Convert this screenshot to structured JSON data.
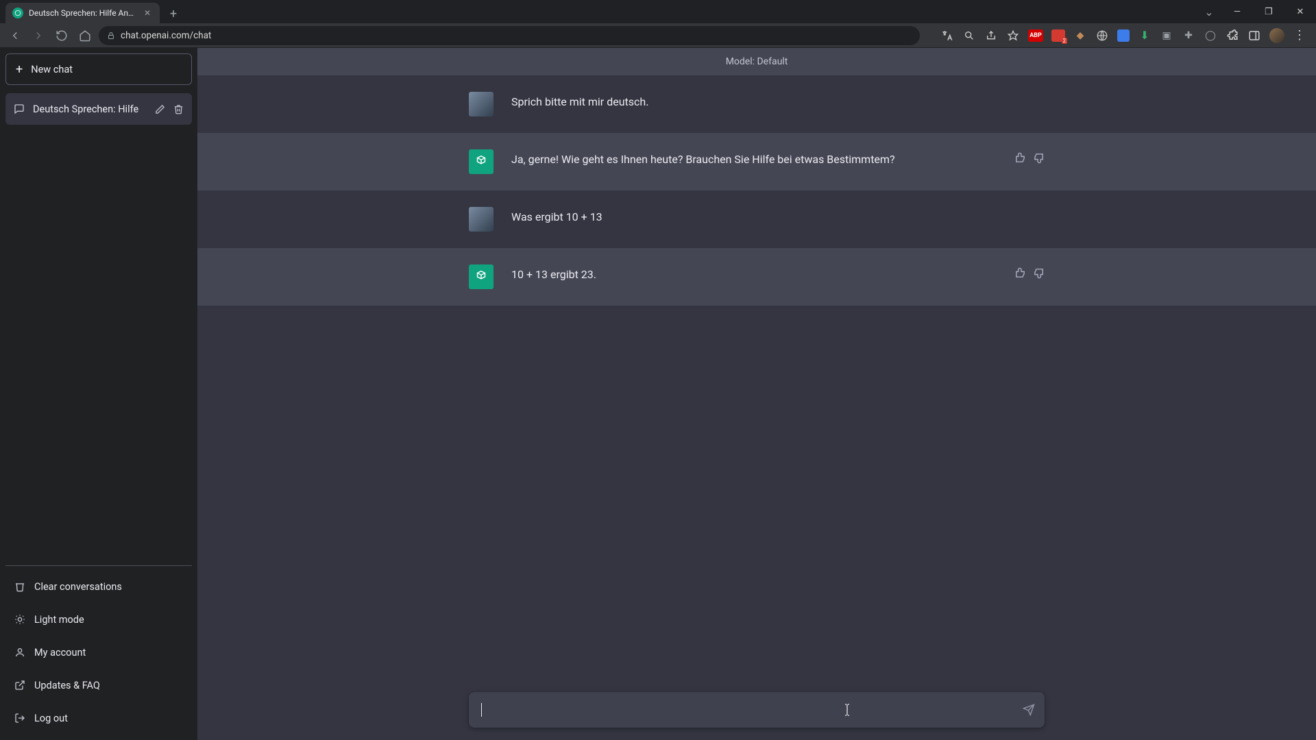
{
  "browser": {
    "tab_title": "Deutsch Sprechen: Hilfe Angebo",
    "url": "chat.openai.com/chat",
    "ext_abp": "ABP",
    "ext_red_badge": "2"
  },
  "sidebar": {
    "new_chat": "New chat",
    "conversations": [
      {
        "title": "Deutsch Sprechen: Hilfe"
      }
    ],
    "footer": {
      "clear": "Clear conversations",
      "light": "Light mode",
      "account": "My account",
      "updates": "Updates & FAQ",
      "logout": "Log out"
    }
  },
  "main": {
    "model_label": "Model: Default",
    "messages": [
      {
        "role": "user",
        "text": "Sprich bitte mit mir deutsch."
      },
      {
        "role": "assistant",
        "text": "Ja, gerne! Wie geht es Ihnen heute? Brauchen Sie Hilfe bei etwas Bestimmtem?"
      },
      {
        "role": "user",
        "text": "Was ergibt 10 + 13"
      },
      {
        "role": "assistant",
        "text": "10 + 13 ergibt 23."
      }
    ],
    "composer_value": ""
  }
}
